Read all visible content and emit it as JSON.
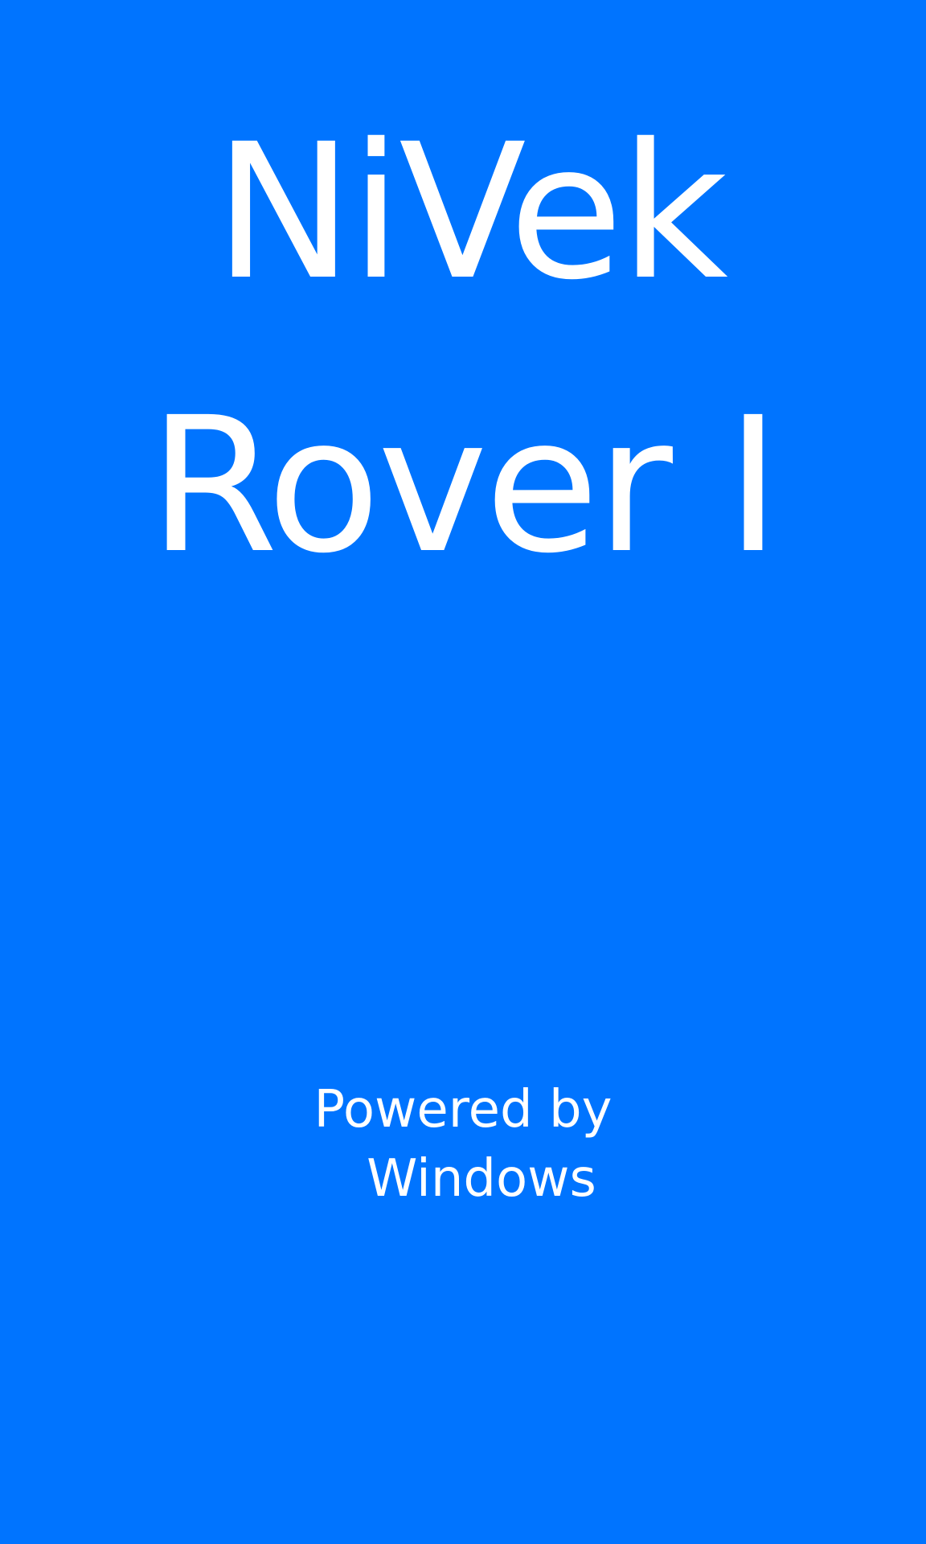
{
  "splash": {
    "title_line1": "NiVek",
    "title_line2": "Rover I",
    "powered_line1": "Powered by",
    "powered_line2": "Windows",
    "background_color": "#0074FF",
    "text_color": "#FFFFFF"
  }
}
